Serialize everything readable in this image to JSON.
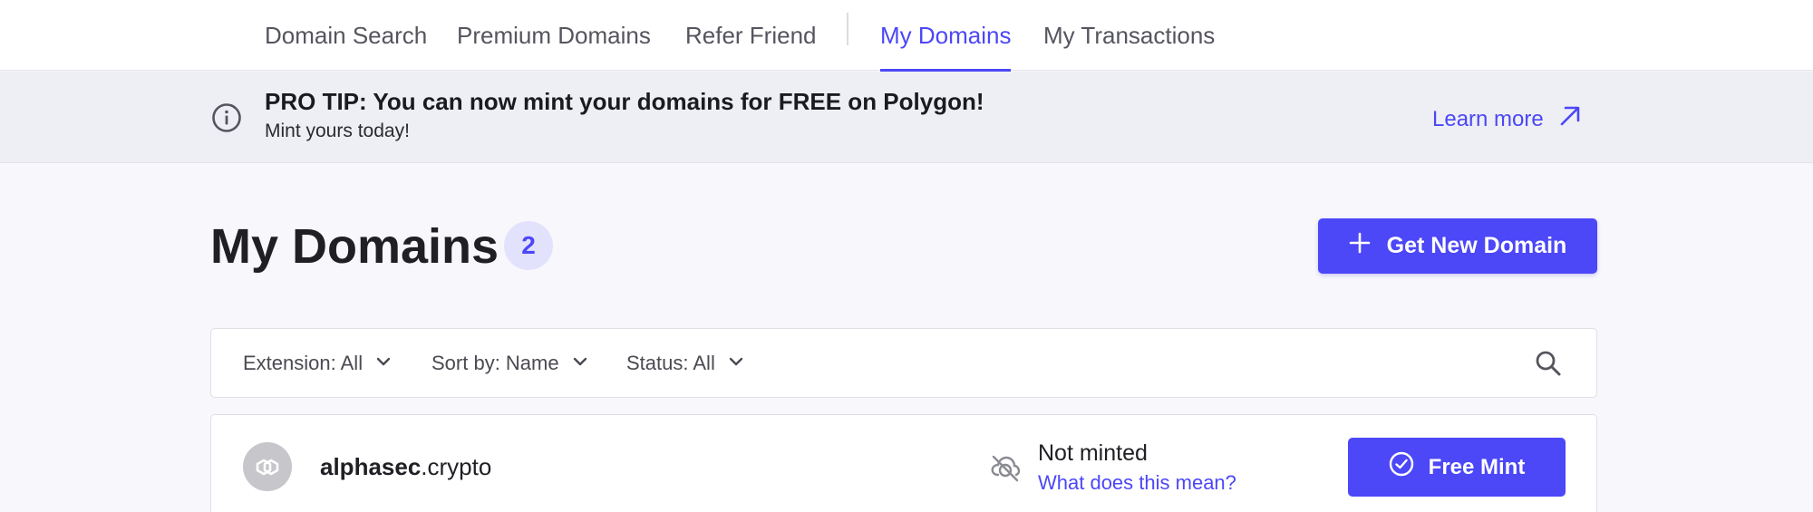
{
  "nav": {
    "items": [
      {
        "label": "Domain Search",
        "active": false
      },
      {
        "label": "Premium Domains",
        "active": false
      },
      {
        "label": "Refer Friend",
        "active": false
      },
      {
        "label": "My Domains",
        "active": true
      },
      {
        "label": "My Transactions",
        "active": false
      }
    ]
  },
  "banner": {
    "icon": "info-icon",
    "title": "PRO TIP: You can now mint your domains for FREE on Polygon!",
    "subtitle": "Mint yours today!",
    "link_label": "Learn more",
    "link_icon": "arrow-up-right-icon"
  },
  "header": {
    "title": "My Domains",
    "count": "2",
    "new_domain_button": "Get New Domain",
    "new_domain_icon": "plus-icon"
  },
  "filters": {
    "extension": "Extension: All",
    "sort": "Sort by: Name",
    "status": "Status: All",
    "search_icon": "search-icon"
  },
  "domains": [
    {
      "name": "alphasec",
      "extension": ".crypto",
      "avatar_icon": "polygon-icon",
      "status_icon": "not-minted-icon",
      "status": "Not minted",
      "status_link": "What does this mean?",
      "action_label": "Free Mint",
      "action_icon": "check-circle-icon"
    }
  ],
  "colors": {
    "accent": "#4c47f7",
    "banner_bg": "#eeeff4",
    "page_bg": "#f7f7fc",
    "badge_bg": "#e3e2fd"
  }
}
